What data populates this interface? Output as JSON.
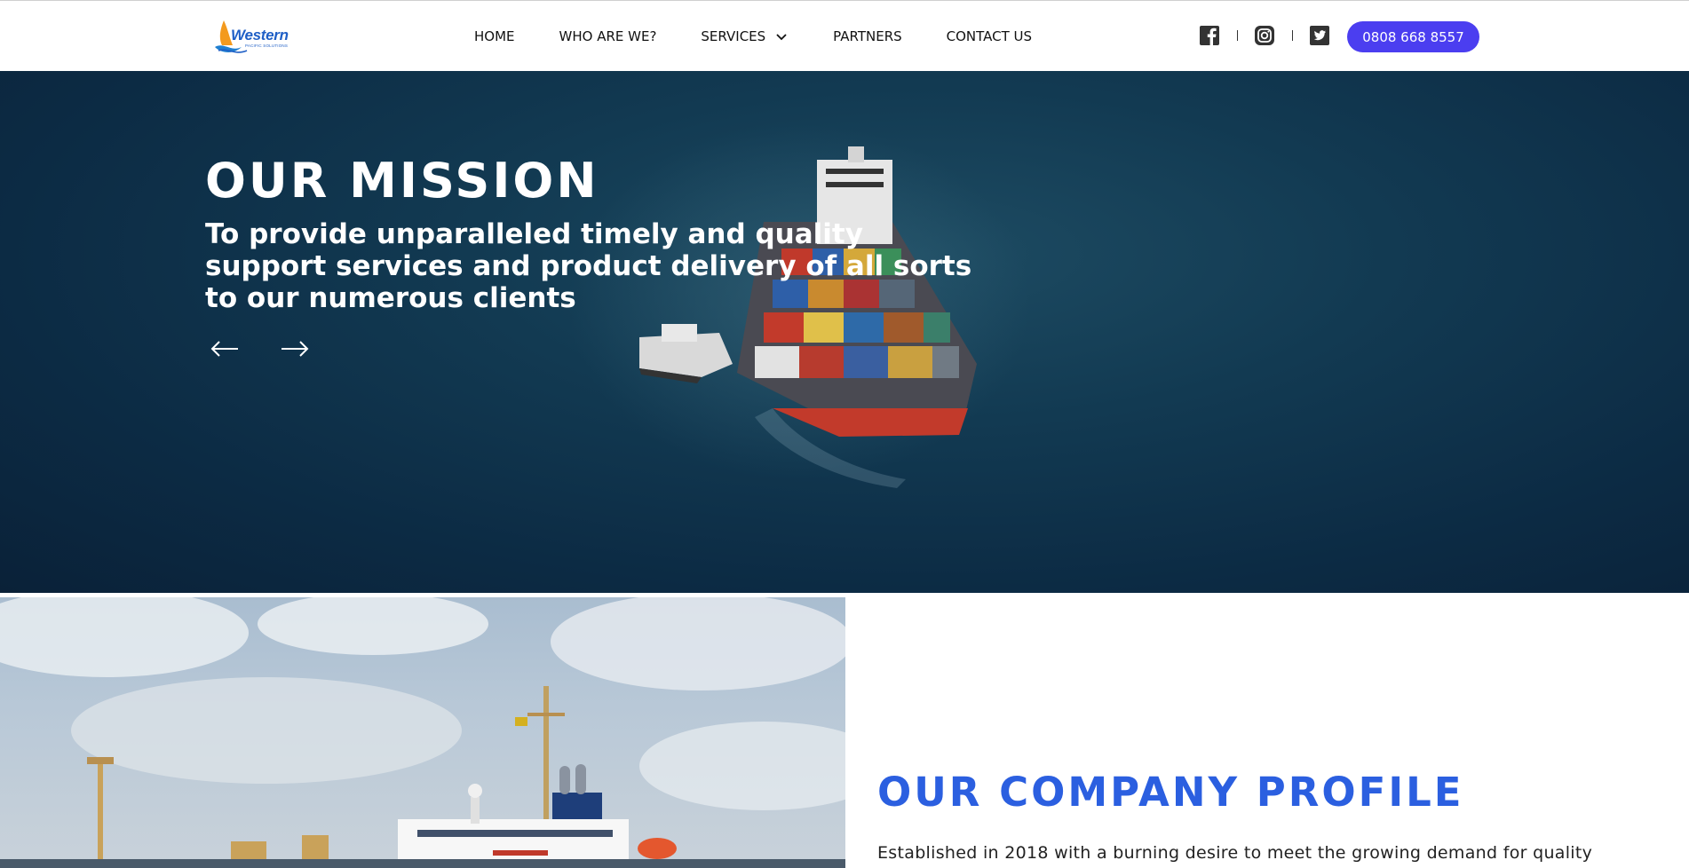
{
  "brand": {
    "logo_name": "Western",
    "logo_tagline": "PACIFIC SOLUTIONS",
    "accent_color": "#4b3ef0",
    "heading_blue": "#2b5fe0"
  },
  "nav": {
    "items": [
      {
        "label": "HOME"
      },
      {
        "label": "WHO ARE WE?"
      },
      {
        "label": "SERVICES",
        "has_dropdown": true
      },
      {
        "label": "PARTNERS"
      },
      {
        "label": "CONTACT US"
      }
    ]
  },
  "socials": {
    "icons": [
      "facebook-icon",
      "instagram-icon",
      "twitter-icon"
    ],
    "separator": "|"
  },
  "phone": {
    "label": "0808 668 8557"
  },
  "hero": {
    "title": "OUR MISSION",
    "subtitle": "To provide unparalleled timely and quality support services and product delivery of all sorts to our numerous clients",
    "prev_icon": "arrow-left-icon",
    "next_icon": "arrow-right-icon"
  },
  "profile": {
    "title": "OUR COMPANY PROFILE",
    "text": "Established in 2018 with a burning desire to meet the growing demand for quality"
  }
}
